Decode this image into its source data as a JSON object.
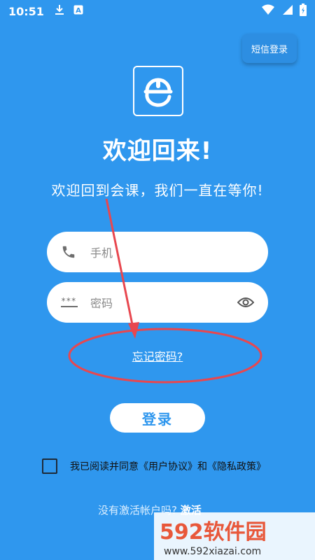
{
  "status_bar": {
    "time": "10:51",
    "download_icon": "download-icon",
    "notification_icon": "a-badge-icon"
  },
  "sms_login_label": "短信登录",
  "title": "欢迎回来!",
  "subtitle": "欢迎回到会课，我们一直在等你!",
  "phone": {
    "placeholder": "手机",
    "value": ""
  },
  "password": {
    "placeholder": "密码",
    "value": "",
    "mask_hint": "***"
  },
  "forgot_label": "忘记密码?",
  "login_label": "登录",
  "agreement": {
    "checked": false,
    "text": "我已阅读并同意《用户协议》和《隐私政策》"
  },
  "activate": {
    "prompt": "没有激活帐户吗?",
    "link": "激活"
  },
  "watermark": {
    "brand": "592软件园",
    "url": "www.592xiazai.com"
  },
  "colors": {
    "background": "#2f97ee",
    "annotation": "#e8474f",
    "watermark": "#e8573a"
  }
}
